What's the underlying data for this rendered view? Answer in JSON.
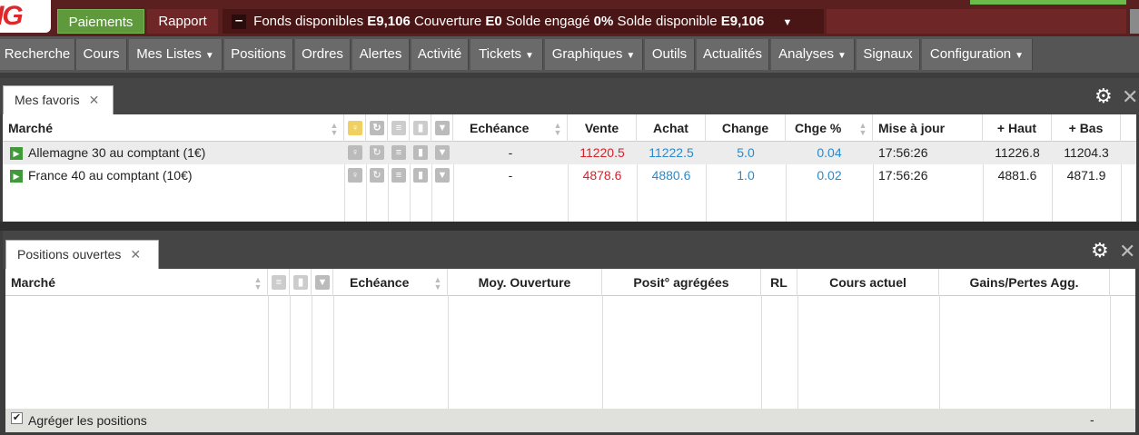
{
  "brand": {
    "logo_text": "IG"
  },
  "topbar": {
    "paiements": "Paiements",
    "rapport": "Rapport",
    "funds_label": "Fonds disponibles",
    "funds_value": "E9,106",
    "couverture_label": "Couverture",
    "couverture_value": "E0",
    "engage_label": "Solde engagé",
    "engage_value": "0%",
    "dispo_label": "Solde disponible",
    "dispo_value": "E9,106"
  },
  "nav": {
    "items": [
      "Recherche",
      "Cours",
      "Mes Listes",
      "Positions",
      "Ordres",
      "Alertes",
      "Activité",
      "Tickets",
      "Graphiques",
      "Outils",
      "Actualités",
      "Analyses",
      "Signaux",
      "Configuration"
    ]
  },
  "favoris": {
    "tab_label": "Mes favoris",
    "columns": {
      "marche": "Marché",
      "echeance": "Echéance",
      "vente": "Vente",
      "achat": "Achat",
      "change": "Change",
      "chge_pct": "Chge %",
      "maj": "Mise à jour",
      "haut": "+ Haut",
      "bas": "+ Bas"
    },
    "rows": [
      {
        "marche": "Allemagne 30 au comptant (1€)",
        "echeance": "-",
        "vente": "11220.5",
        "achat": "11222.5",
        "change": "5.0",
        "chge_pct": "0.04",
        "maj": "17:56:26",
        "haut": "11226.8",
        "bas": "11204.3"
      },
      {
        "marche": "France 40 au comptant (10€)",
        "echeance": "-",
        "vente": "4878.6",
        "achat": "4880.6",
        "change": "1.0",
        "chge_pct": "0.02",
        "maj": "17:56:26",
        "haut": "4881.6",
        "bas": "4871.9"
      }
    ]
  },
  "positions": {
    "tab_label": "Positions ouvertes",
    "columns": {
      "marche": "Marché",
      "echeance": "Echéance",
      "moy": "Moy. Ouverture",
      "posit": "Posit° agrégées",
      "rl": "RL",
      "cours": "Cours actuel",
      "gains": "Gains/Pertes Agg."
    },
    "footer_label": "Agréger les positions",
    "footer_value": "-"
  },
  "colors": {
    "sell": "#d3222a",
    "buy": "#2a8ac9",
    "accent_green": "#5e9a3c",
    "brand_red": "#e0282a"
  }
}
